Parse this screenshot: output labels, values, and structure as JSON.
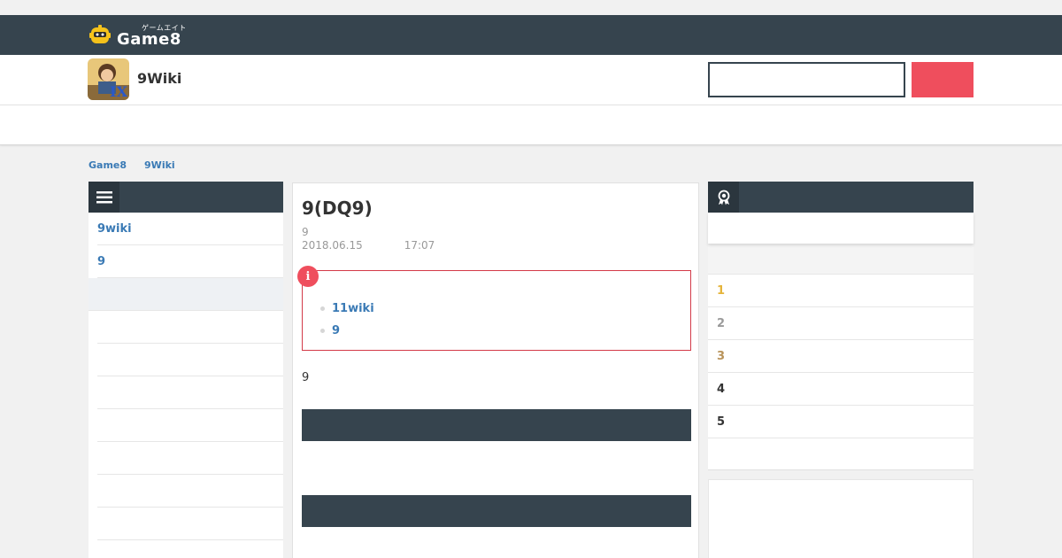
{
  "site": {
    "logo_kana": "ゲームエイト",
    "logo_text": "Game8"
  },
  "header": {
    "wiki_title": "9Wiki",
    "search_placeholder": ""
  },
  "breadcrumb": [
    "Game8",
    "9Wiki"
  ],
  "left_sidebar": {
    "items": [
      "9wiki",
      "9"
    ]
  },
  "article": {
    "title": "9(DQ9)",
    "meta_line": "9",
    "date": "2018.06.15",
    "time": "17:07",
    "notice_icon": "i",
    "notice_links": [
      "11wiki",
      "9"
    ],
    "body_text": "9"
  },
  "ranking": {
    "items": [
      {
        "label": "1",
        "color": "#e5b43b"
      },
      {
        "label": "2",
        "color": "#9a9a9a"
      },
      {
        "label": "3",
        "color": "#b8935a"
      },
      {
        "label": "4",
        "color": "#333333"
      },
      {
        "label": "5",
        "color": "#333333"
      }
    ]
  },
  "colors": {
    "accent": "#ef4e5d",
    "dark": "#36444e",
    "link": "#3a7ab5"
  }
}
